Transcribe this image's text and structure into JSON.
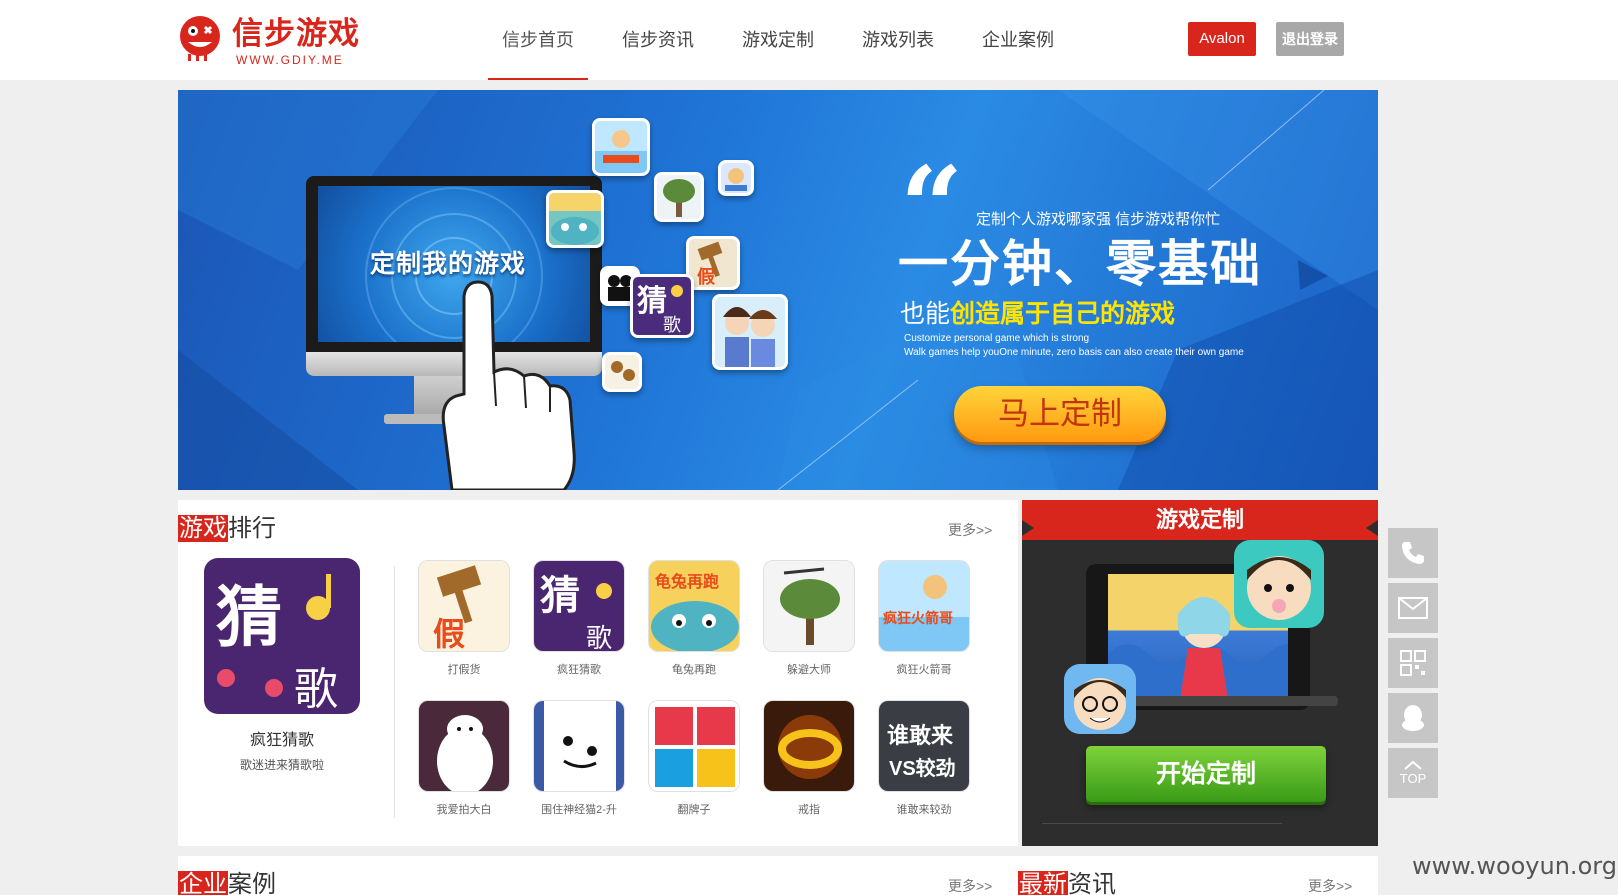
{
  "header": {
    "logo": {
      "text": "信步游戏",
      "sub": "WWW.GDIY.ME"
    },
    "nav": [
      {
        "label": "信步首页",
        "active": true
      },
      {
        "label": "信步资讯"
      },
      {
        "label": "游戏定制"
      },
      {
        "label": "游戏列表"
      },
      {
        "label": "企业案例"
      }
    ],
    "user_label": "Avalon",
    "logout_label": "退出登录"
  },
  "banner": {
    "screen_title": "定制我的游戏",
    "quote": "“",
    "subtitle": "定制个人游戏哪家强 信步游戏帮你忙",
    "title": "一分钟、零基础",
    "line3_prefix": "也能",
    "line3_highlight": "创造属于自己的游戏",
    "en_line1": "Customize personal game which is strong",
    "en_line2": "Walk games help youOne minute, zero basis can also create their own game",
    "cta_label": "马上定制"
  },
  "ranking": {
    "title_highlight": "游戏",
    "title_rest": "排行",
    "more_label": "更多>>",
    "feature": {
      "name": "疯狂猜歌",
      "desc": "歌迷进来猜歌啦"
    },
    "games": [
      {
        "name": "打假货"
      },
      {
        "name": "疯狂猜歌"
      },
      {
        "name": "龟兔再跑"
      },
      {
        "name": "躲避大师"
      },
      {
        "name": "疯狂火箭哥"
      },
      {
        "name": "我爱拍大白"
      },
      {
        "name": "围住神经猫2-升"
      },
      {
        "name": "翻牌子"
      },
      {
        "name": "戒指"
      },
      {
        "name": "谁敢来较劲"
      }
    ],
    "icon_text": {
      "fake": "假",
      "guess": "猜",
      "song": "歌",
      "turtle": "龟兔再跑",
      "rocket": "疯狂火箭哥",
      "vs_top": "谁敢来",
      "vs_bottom": "VS较劲"
    }
  },
  "customize": {
    "title": "游戏定制",
    "start_label": "开始定制"
  },
  "cases": {
    "title_highlight": "企业",
    "title_rest": "案例",
    "more_label": "更多>>"
  },
  "news": {
    "title_highlight": "最新",
    "title_rest": "资讯",
    "more_label": "更多>>"
  },
  "side_tools": [
    {
      "icon": "phone-icon"
    },
    {
      "icon": "mail-icon"
    },
    {
      "icon": "qr-code-icon"
    },
    {
      "icon": "qq-icon"
    },
    {
      "icon": "back-to-top-icon",
      "label": "TOP"
    }
  ],
  "watermark": "www.wooyun.org",
  "colors": {
    "brand_red": "#d9261c",
    "banner_blue": "#1f74d6",
    "cta_orange": "#ff9a10",
    "start_green": "#3a9a17"
  }
}
